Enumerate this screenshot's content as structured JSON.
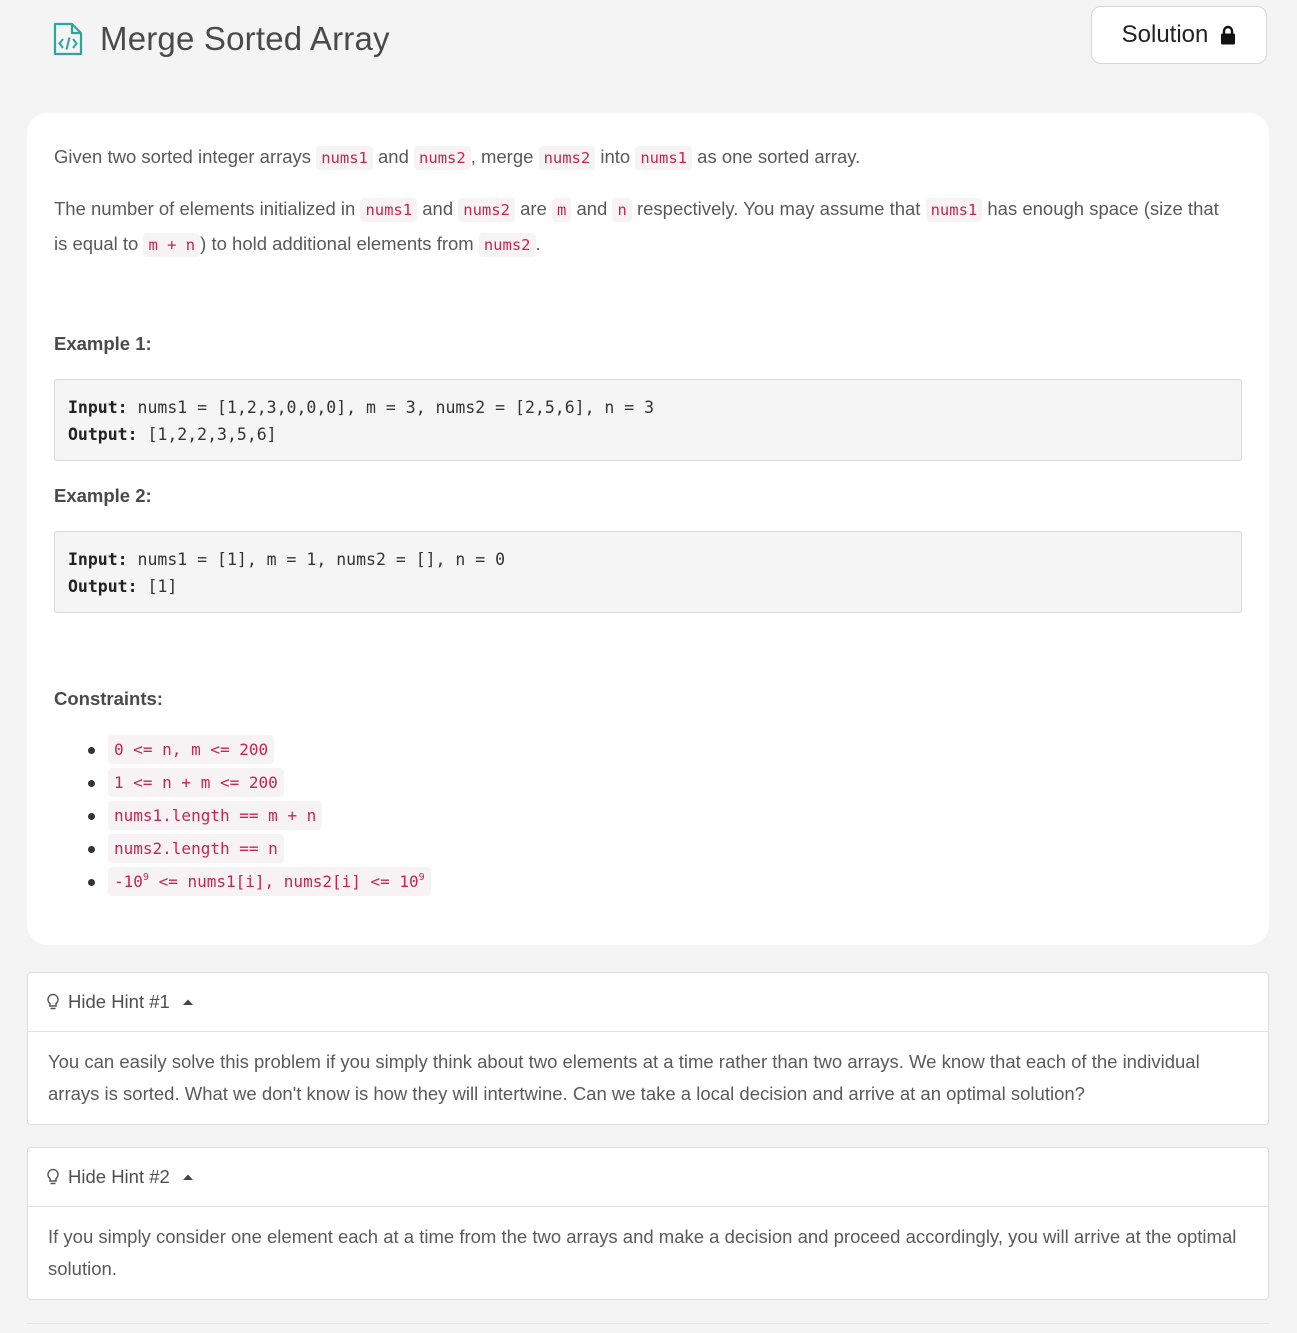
{
  "header": {
    "title": "Merge Sorted Array",
    "solution_label": "Solution",
    "icons": {
      "file": "code-file-icon",
      "lock": "lock-icon"
    },
    "accent_color": "#2aa8a0"
  },
  "description": {
    "p1": {
      "t1": "Given two sorted integer arrays ",
      "c1": "nums1",
      "t2": " and ",
      "c2": "nums2",
      "t3": ", merge ",
      "c3": "nums2",
      "t4": " into ",
      "c4": "nums1",
      "t5": " as one sorted array."
    },
    "p2": {
      "t1": "The number of elements initialized in ",
      "c1": "nums1",
      "t2": " and ",
      "c2": "nums2",
      "t3": " are ",
      "c3": "m",
      "t4": " and ",
      "c4": "n",
      "t5": " respectively. You may assume that ",
      "c5": "nums1",
      "t6": " has enough space (size that is equal to ",
      "c6": "m + n",
      "t7": ") to hold additional elements from ",
      "c7": "nums2",
      "t8": "."
    }
  },
  "examples": [
    {
      "heading": "Example 1:",
      "input_label": "Input:",
      "input_value": " nums1 = [1,2,3,0,0,0], m = 3, nums2 = [2,5,6], n = 3",
      "output_label": "Output:",
      "output_value": " [1,2,2,3,5,6]"
    },
    {
      "heading": "Example 2:",
      "input_label": "Input:",
      "input_value": " nums1 = [1], m = 1, nums2 = [], n = 0",
      "output_label": "Output:",
      "output_value": " [1]"
    }
  ],
  "constraints": {
    "heading": "Constraints:",
    "items": [
      "0 <= n, m <= 200",
      "1 <= n + m <= 200",
      "nums1.length == m + n",
      "nums2.length == n"
    ],
    "last_item": {
      "a": "-10",
      "sup1": "9",
      "b": " <= nums1[i], nums2[i] <= 10",
      "sup2": "9"
    }
  },
  "hints": [
    {
      "label": "Hide Hint #1",
      "text": "You can easily solve this problem if you simply think about two elements at a time rather than two arrays. We know that each of the individual arrays is sorted. What we don't know is how they will intertwine. Can we take a local decision and arrive at an optimal solution?"
    },
    {
      "label": "Hide Hint #2",
      "text": "If you simply consider one element each at a time from the two arrays and make a decision and proceed accordingly, you will arrive at the optimal solution."
    }
  ]
}
